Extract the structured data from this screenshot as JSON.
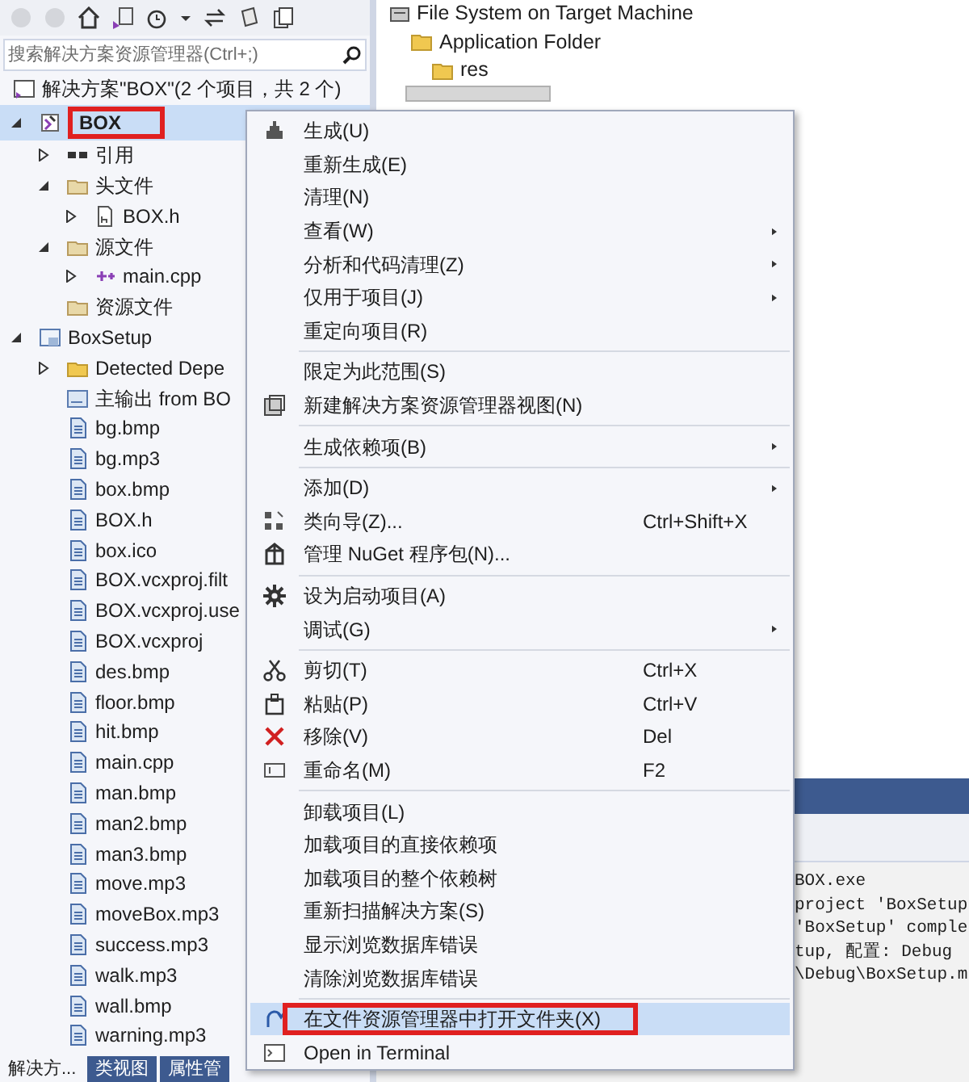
{
  "solution_explorer": {
    "search": {
      "placeholder": "搜索解决方案资源管理器(Ctrl+;)"
    },
    "tree": [
      {
        "label": "解决方案\"BOX\"(2 个项目，共 2 个)",
        "kind": "solution",
        "selected": false,
        "annotated": false,
        "children": [
          {
            "label": "BOX",
            "kind": "project",
            "expanded": true,
            "selected": true,
            "annotated": true,
            "children": [
              {
                "label": "引用",
                "kind": "references",
                "expanded": false,
                "selected": false,
                "annotated": false
              },
              {
                "label": "头文件",
                "kind": "filter",
                "expanded": true,
                "selected": false,
                "annotated": false,
                "children": [
                  {
                    "label": "BOX.h",
                    "kind": "header",
                    "expanded": false,
                    "selected": false,
                    "annotated": false
                  }
                ]
              },
              {
                "label": "源文件",
                "kind": "filter",
                "expanded": true,
                "selected": false,
                "annotated": false,
                "children": [
                  {
                    "label": "main.cpp",
                    "kind": "source",
                    "expanded": false,
                    "selected": false,
                    "annotated": false
                  }
                ]
              },
              {
                "label": "资源文件",
                "kind": "filter",
                "selected": false,
                "annotated": false
              }
            ]
          },
          {
            "label": "BoxSetup",
            "kind": "setup",
            "expanded": true,
            "selected": false,
            "annotated": false,
            "children": [
              {
                "label": "Detected Depe",
                "kind": "folder",
                "expanded": false,
                "selected": false,
                "annotated": false
              },
              {
                "label": "主输出 from BO",
                "kind": "output",
                "selected": false,
                "annotated": false
              },
              {
                "label": "bg.bmp",
                "kind": "file",
                "selected": false,
                "annotated": false
              },
              {
                "label": "bg.mp3",
                "kind": "file",
                "selected": false,
                "annotated": false
              },
              {
                "label": "box.bmp",
                "kind": "file",
                "selected": false,
                "annotated": false
              },
              {
                "label": "BOX.h",
                "kind": "file",
                "selected": false,
                "annotated": false
              },
              {
                "label": "box.ico",
                "kind": "file",
                "selected": false,
                "annotated": false
              },
              {
                "label": "BOX.vcxproj.filt",
                "kind": "file",
                "selected": false,
                "annotated": false
              },
              {
                "label": "BOX.vcxproj.use",
                "kind": "file",
                "selected": false,
                "annotated": false
              },
              {
                "label": "BOX.vcxproj",
                "kind": "file",
                "selected": false,
                "annotated": false
              },
              {
                "label": "des.bmp",
                "kind": "file",
                "selected": false,
                "annotated": false
              },
              {
                "label": "floor.bmp",
                "kind": "file",
                "selected": false,
                "annotated": false
              },
              {
                "label": "hit.bmp",
                "kind": "file",
                "selected": false,
                "annotated": false
              },
              {
                "label": "main.cpp",
                "kind": "file",
                "selected": false,
                "annotated": false
              },
              {
                "label": "man.bmp",
                "kind": "file",
                "selected": false,
                "annotated": false
              },
              {
                "label": "man2.bmp",
                "kind": "file",
                "selected": false,
                "annotated": false
              },
              {
                "label": "man3.bmp",
                "kind": "file",
                "selected": false,
                "annotated": false
              },
              {
                "label": "move.mp3",
                "kind": "file",
                "selected": false,
                "annotated": false
              },
              {
                "label": "moveBox.mp3",
                "kind": "file",
                "selected": false,
                "annotated": false
              },
              {
                "label": "success.mp3",
                "kind": "file",
                "selected": false,
                "annotated": false
              },
              {
                "label": "walk.mp3",
                "kind": "file",
                "selected": false,
                "annotated": false
              },
              {
                "label": "wall.bmp",
                "kind": "file",
                "selected": false,
                "annotated": false
              },
              {
                "label": "warning.mp3",
                "kind": "file",
                "selected": false,
                "annotated": false
              }
            ]
          }
        ]
      }
    ],
    "tabs": [
      {
        "label": "解决方...",
        "selected": true
      },
      {
        "label": "类视图",
        "selected": false
      },
      {
        "label": "属性管",
        "selected": false
      }
    ]
  },
  "file_system": {
    "items": [
      {
        "label": "File System on Target Machine",
        "children": [
          {
            "label": "Application Folder",
            "children": [
              {
                "label": "res"
              }
            ]
          }
        ]
      }
    ]
  },
  "output": {
    "lines": [
      "BOX.exe",
      "project 'BoxSetup",
      "'BoxSetup' comple",
      "tup, 配置: Debug",
      "\\Debug\\BoxSetup.m"
    ]
  },
  "context_menu": {
    "items": [
      {
        "kind": "item",
        "label": "生成(U)",
        "submenu": false,
        "selected": false,
        "annotated": false
      },
      {
        "kind": "item",
        "label": "重新生成(E)",
        "submenu": false,
        "selected": false,
        "annotated": false
      },
      {
        "kind": "item",
        "label": "清理(N)",
        "submenu": false,
        "selected": false,
        "annotated": false
      },
      {
        "kind": "item",
        "label": "查看(W)",
        "submenu": true,
        "selected": false,
        "annotated": false
      },
      {
        "kind": "item",
        "label": "分析和代码清理(Z)",
        "submenu": true,
        "selected": false,
        "annotated": false
      },
      {
        "kind": "item",
        "label": "仅用于项目(J)",
        "submenu": true,
        "selected": false,
        "annotated": false
      },
      {
        "kind": "item",
        "label": "重定向项目(R)",
        "submenu": false,
        "selected": false,
        "annotated": false
      },
      {
        "kind": "separator"
      },
      {
        "kind": "item",
        "label": "限定为此范围(S)",
        "submenu": false,
        "selected": false,
        "annotated": false
      },
      {
        "kind": "item",
        "label": "新建解决方案资源管理器视图(N)",
        "submenu": false,
        "selected": false,
        "annotated": false
      },
      {
        "kind": "separator"
      },
      {
        "kind": "item",
        "label": "生成依赖项(B)",
        "submenu": true,
        "selected": false,
        "annotated": false
      },
      {
        "kind": "separator"
      },
      {
        "kind": "item",
        "label": "添加(D)",
        "submenu": true,
        "selected": false,
        "annotated": false
      },
      {
        "kind": "item",
        "label": "类向导(Z)...",
        "shortcut": "Ctrl+Shift+X",
        "submenu": false,
        "selected": false,
        "annotated": false
      },
      {
        "kind": "item",
        "label": "管理 NuGet 程序包(N)...",
        "submenu": false,
        "selected": false,
        "annotated": false
      },
      {
        "kind": "separator"
      },
      {
        "kind": "item",
        "label": "设为启动项目(A)",
        "submenu": false,
        "selected": false,
        "annotated": false
      },
      {
        "kind": "item",
        "label": "调试(G)",
        "submenu": true,
        "selected": false,
        "annotated": false
      },
      {
        "kind": "separator"
      },
      {
        "kind": "item",
        "label": "剪切(T)",
        "shortcut": "Ctrl+X",
        "submenu": false,
        "selected": false,
        "annotated": false
      },
      {
        "kind": "item",
        "label": "粘贴(P)",
        "shortcut": "Ctrl+V",
        "submenu": false,
        "selected": false,
        "annotated": false
      },
      {
        "kind": "item",
        "label": "移除(V)",
        "shortcut": "Del",
        "submenu": false,
        "selected": false,
        "annotated": false
      },
      {
        "kind": "item",
        "label": "重命名(M)",
        "shortcut": "F2",
        "submenu": false,
        "selected": false,
        "annotated": false
      },
      {
        "kind": "separator"
      },
      {
        "kind": "item",
        "label": "卸载项目(L)",
        "submenu": false,
        "selected": false,
        "annotated": false
      },
      {
        "kind": "item",
        "label": "加载项目的直接依赖项",
        "submenu": false,
        "selected": false,
        "annotated": false
      },
      {
        "kind": "item",
        "label": "加载项目的整个依赖树",
        "submenu": false,
        "selected": false,
        "annotated": false
      },
      {
        "kind": "item",
        "label": "重新扫描解决方案(S)",
        "submenu": false,
        "selected": false,
        "annotated": false
      },
      {
        "kind": "item",
        "label": "显示浏览数据库错误",
        "submenu": false,
        "selected": false,
        "annotated": false
      },
      {
        "kind": "item",
        "label": "清除浏览数据库错误",
        "submenu": false,
        "selected": false,
        "annotated": false
      },
      {
        "kind": "separator"
      },
      {
        "kind": "item",
        "label": "在文件资源管理器中打开文件夹(X)",
        "submenu": false,
        "selected": true,
        "annotated": true
      },
      {
        "kind": "item",
        "label": "Open in Terminal",
        "submenu": false,
        "selected": false,
        "annotated": false
      }
    ]
  }
}
